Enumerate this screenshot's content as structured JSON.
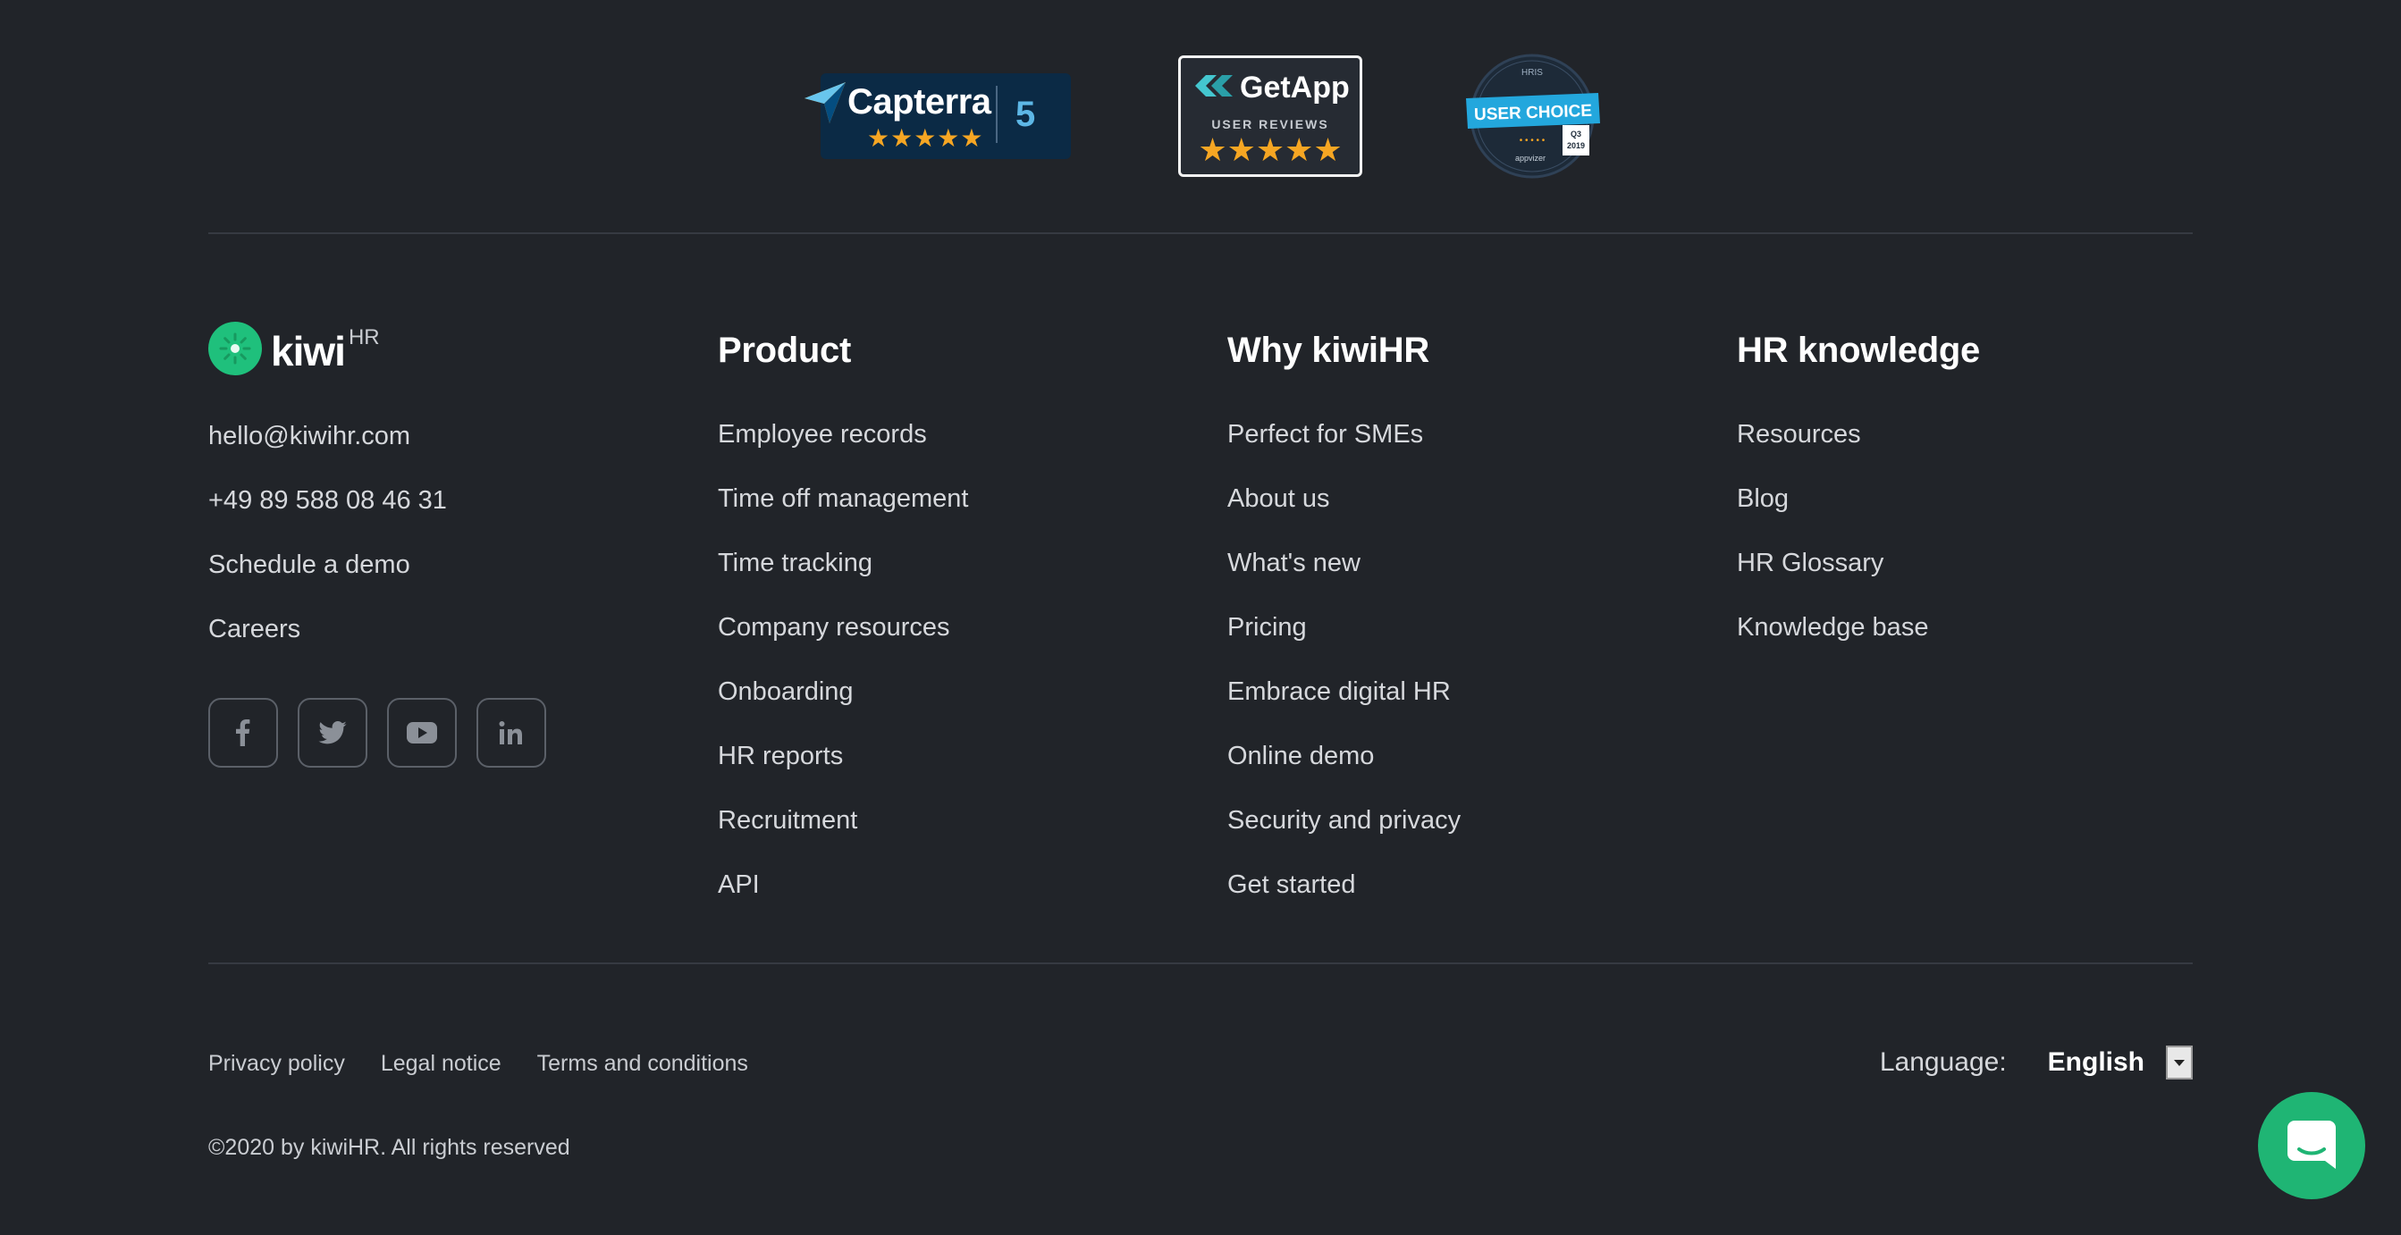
{
  "badges": {
    "capterra": {
      "name": "Capterra",
      "score": "5",
      "stars": "★★★★★"
    },
    "getapp": {
      "name": "GetApp",
      "subtitle": "USER REVIEWS",
      "stars": "★★★★★"
    },
    "userchoice": {
      "top": "HRIS",
      "label": "USER CHOICE",
      "quarter": "Q3",
      "year": "2019",
      "footer": "appvizer"
    }
  },
  "brand": {
    "name": "kiwi",
    "suffix": "HR",
    "accent": "#1fc07c"
  },
  "contact": {
    "email": "hello@kiwihr.com",
    "phone": "+49 89 588 08 46 31",
    "demo": "Schedule a demo",
    "careers": "Careers"
  },
  "social": [
    "facebook-icon",
    "twitter-icon",
    "youtube-icon",
    "linkedin-icon"
  ],
  "columns": {
    "product": {
      "title": "Product",
      "links": [
        "Employee records",
        "Time off management",
        "Time tracking",
        "Company resources",
        "Onboarding",
        "HR reports",
        "Recruitment",
        "API"
      ]
    },
    "why": {
      "title": "Why kiwiHR",
      "links": [
        "Perfect for SMEs",
        "About us",
        "What's new",
        "Pricing",
        "Embrace digital HR",
        "Online demo",
        "Security and privacy",
        "Get started"
      ]
    },
    "knowledge": {
      "title": "HR knowledge",
      "links": [
        "Resources",
        "Blog",
        "HR Glossary",
        "Knowledge base"
      ]
    }
  },
  "legal": {
    "privacy": "Privacy policy",
    "notice": "Legal notice",
    "terms": "Terms and conditions"
  },
  "copyright": "©2020 by kiwiHR. All rights reserved",
  "language": {
    "label": "Language:",
    "value": "English"
  },
  "colors": {
    "background": "#212429",
    "accent": "#1fc07c",
    "star": "#f6a623"
  }
}
